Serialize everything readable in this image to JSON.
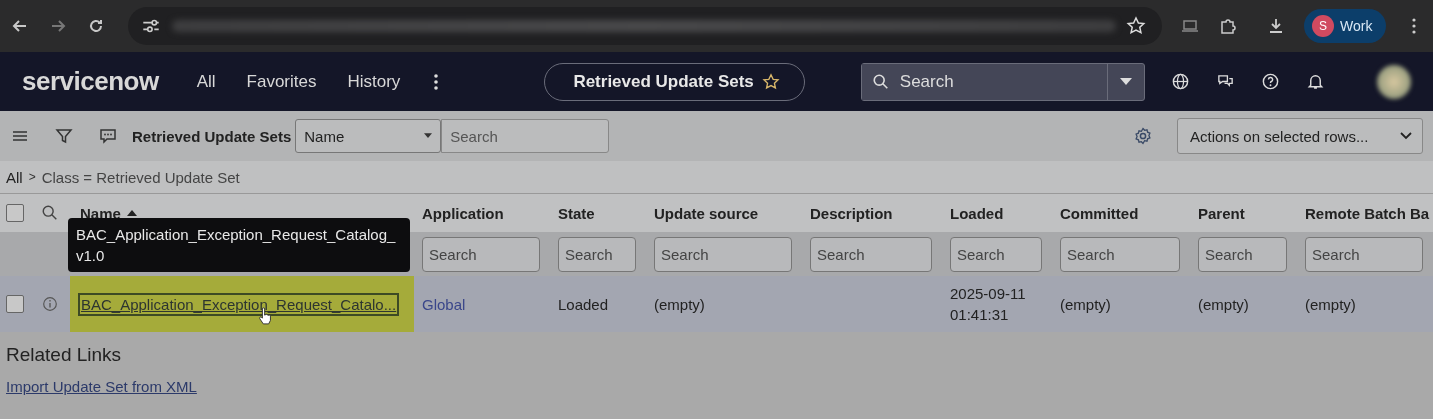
{
  "browser": {
    "profile_initial": "S",
    "profile_label": "Work"
  },
  "nav": {
    "logo": "servicenow",
    "menu": [
      "All",
      "Favorites",
      "History"
    ],
    "title": "Retrieved Update Sets",
    "starred": false,
    "search_placeholder": "Search"
  },
  "list_toolbar": {
    "title": "Retrieved Update Sets",
    "field": "Name",
    "search_placeholder": "Search",
    "actions": "Actions on selected rows..."
  },
  "breadcrumb": {
    "items": [
      "All",
      "Class = Retrieved Update Set"
    ],
    "separator": ">"
  },
  "table": {
    "all_checked": false,
    "columns": [
      {
        "label": "Name",
        "sorted": true
      },
      {
        "label": "Application",
        "sorted": false,
        "filter_placeholder": "Search"
      },
      {
        "label": "State",
        "sorted": false,
        "filter_placeholder": "Search"
      },
      {
        "label": "Update source",
        "sorted": false,
        "filter_placeholder": "Search"
      },
      {
        "label": "Description",
        "sorted": false,
        "filter_placeholder": "Search"
      },
      {
        "label": "Loaded",
        "sorted": false,
        "filter_placeholder": "Search"
      },
      {
        "label": "Committed",
        "sorted": false,
        "filter_placeholder": "Search"
      },
      {
        "label": "Parent",
        "sorted": false,
        "filter_placeholder": "Search"
      },
      {
        "label": "Remote Batch Ba",
        "sorted": false,
        "filter_placeholder": "Search"
      }
    ],
    "rows": [
      {
        "checked": false,
        "hovered": true,
        "name": "BAC_Application_Exception_Request_Catalo...",
        "application": "Global",
        "state": "Loaded",
        "update_source": "(empty)",
        "loaded": "2025-09-11 01:41:31",
        "committed": "(empty)",
        "parent": "(empty)",
        "column_9": "(empty)"
      }
    ]
  },
  "tooltip": "BAC_Application_Exception_Request_Catalog_v1.0",
  "related_links": {
    "title": "Related Links",
    "links": [
      "Import Update Set from XML"
    ]
  }
}
